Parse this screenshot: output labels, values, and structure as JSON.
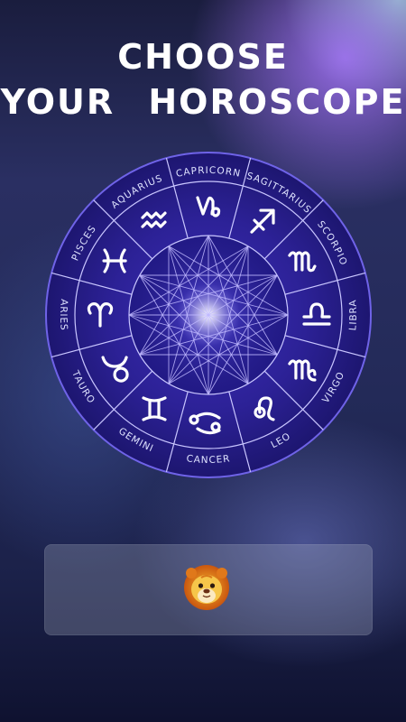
{
  "title": {
    "line1": "CHOOSE",
    "line2": "YOUR HOROSCOPE"
  },
  "wheel": {
    "signs": [
      {
        "name": "SAGITTARIUS",
        "icon": "sagittarius-icon"
      },
      {
        "name": "SCORPIO",
        "icon": "scorpio-icon"
      },
      {
        "name": "LIBRA",
        "icon": "libra-icon"
      },
      {
        "name": "VIRGO",
        "icon": "virgo-icon"
      },
      {
        "name": "LEO",
        "icon": "leo-icon"
      },
      {
        "name": "CANCER",
        "icon": "cancer-icon"
      },
      {
        "name": "GEMINI",
        "icon": "gemini-icon"
      },
      {
        "name": "TAURO",
        "icon": "taurus-icon"
      },
      {
        "name": "ARIES",
        "icon": "aries-icon"
      },
      {
        "name": "PISCES",
        "icon": "pisces-icon"
      },
      {
        "name": "AQUARIUS",
        "icon": "aquarius-icon"
      },
      {
        "name": "CAPRICORN",
        "icon": "capricorn-icon"
      }
    ],
    "colors": {
      "outer": "#2a1f8c",
      "inner": "#241a7e",
      "line": "#c9c6ff"
    }
  },
  "selection": {
    "icon": "lion-face-icon"
  }
}
